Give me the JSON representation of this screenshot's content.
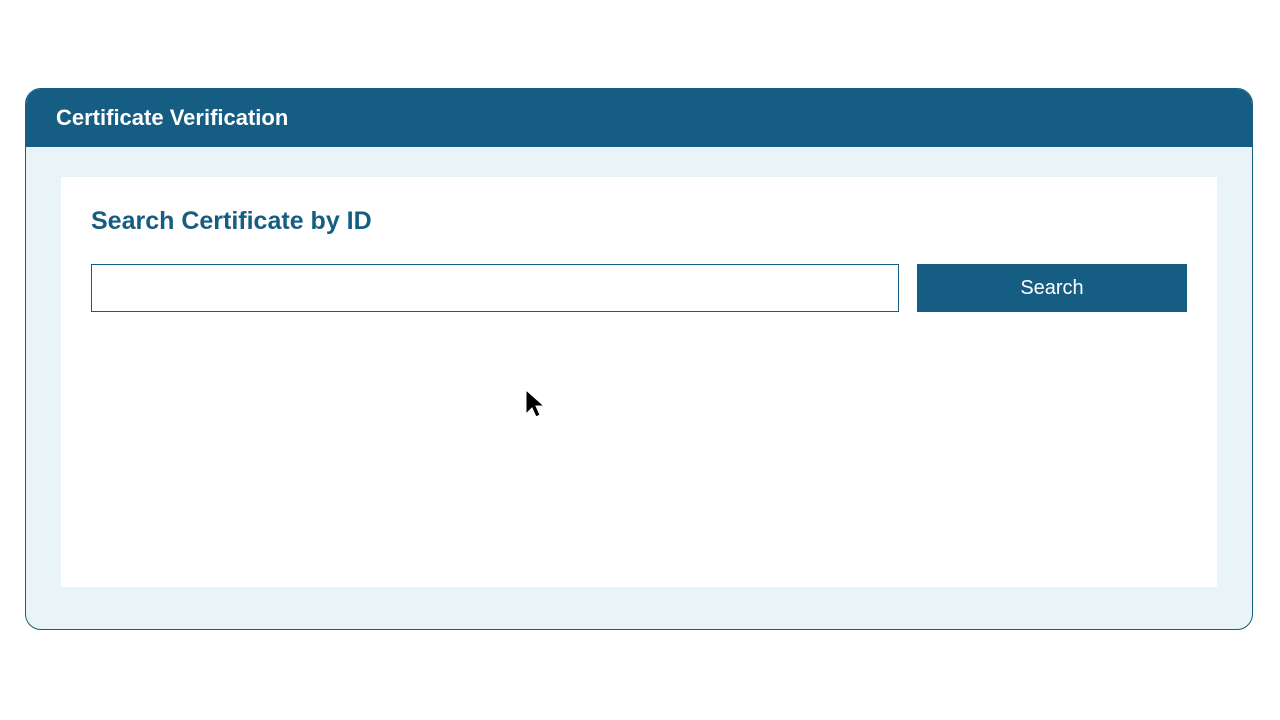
{
  "header": {
    "title": "Certificate Verification"
  },
  "search": {
    "title": "Search Certificate by ID",
    "input_value": "",
    "input_placeholder": "",
    "button_label": "Search"
  },
  "colors": {
    "primary": "#155d82",
    "panel_bg": "#e8f4f8",
    "white": "#ffffff"
  }
}
